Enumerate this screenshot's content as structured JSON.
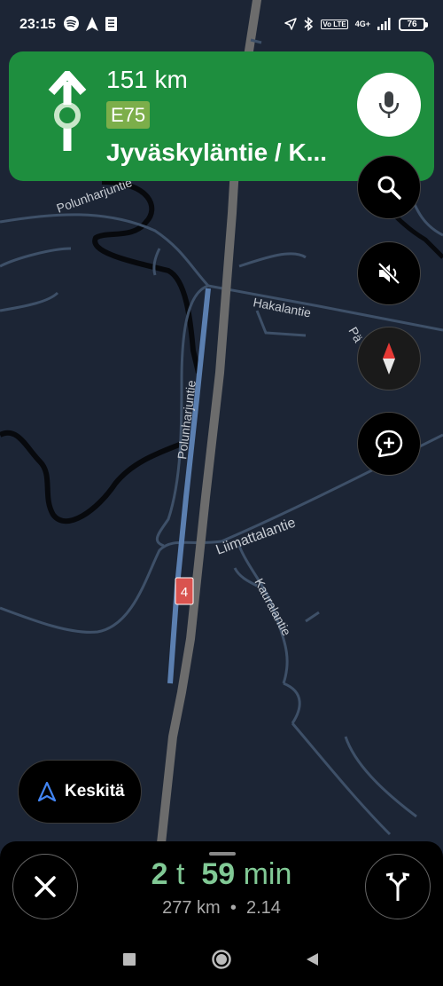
{
  "status_bar": {
    "time": "23:15",
    "left_icons": [
      "spotify-icon",
      "navigation-arrow-icon",
      "document-icon"
    ],
    "right_icons": [
      "location-icon",
      "bluetooth-icon",
      "volte-icon",
      "signal-icon"
    ],
    "volte_label": "Vo LTE",
    "network_label": "4G+",
    "battery": "76"
  },
  "navigation": {
    "distance": "151 km",
    "road_badge": "E75",
    "street": "Jyväskyläntie / K...",
    "turn_icon": "roundabout-straight-icon",
    "card_color": "#1e8e3e",
    "badge_color": "#7cae4a"
  },
  "map": {
    "labels": {
      "polunharjuntie_top": "Polunharjuntie",
      "polunharjuntie_vertical": "Polunharjuntie",
      "hakalantie": "Hakalantie",
      "pa": "Pä",
      "liimattalantie": "Liimattalantie",
      "kauralantie": "Kauralantie",
      "route_marker": "4"
    },
    "background": "#1c2535"
  },
  "controls": {
    "mic": "microphone-icon",
    "search": "search-icon",
    "mute": "mute-icon",
    "compass": "compass-icon",
    "report": "add-report-icon",
    "center_label": "Keskitä"
  },
  "trip": {
    "hours": "2",
    "hours_unit": "t",
    "minutes": "59",
    "minutes_unit": "min",
    "distance": "277 km",
    "separator": "•",
    "arrival": "2.14",
    "eta_color": "#81c995"
  },
  "system_nav": {
    "recents": "square-icon",
    "home": "circle-icon",
    "back": "triangle-back-icon"
  }
}
